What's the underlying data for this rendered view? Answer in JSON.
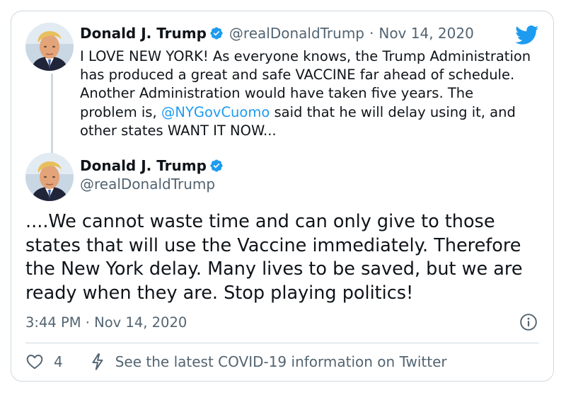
{
  "icons": {
    "logo": "twitter-bird-icon",
    "verified": "verified-badge-icon",
    "info": "info-icon",
    "like": "heart-icon",
    "covid": "lightning-bolt-icon"
  },
  "colors": {
    "accent": "#1d9bf0",
    "secondary_text": "#536471",
    "border": "#cfd9de"
  },
  "tweet1": {
    "name": "Donald J. Trump",
    "handle": "@realDonaldTrump",
    "separator": "·",
    "date": "Nov 14, 2020",
    "text_before": "I LOVE NEW YORK! As everyone knows, the Trump Administration has produced a great and safe VACCINE far ahead of schedule. Another Administration would have taken five years. The problem is, ",
    "mention": "@NYGovCuomo",
    "text_after": " said that he will delay using it, and other states WANT IT NOW..."
  },
  "tweet2": {
    "name": "Donald J. Trump",
    "handle": "@realDonaldTrump",
    "text": "....We cannot waste time and can only give to those states that will use the Vaccine immediately. Therefore the New York delay. Many lives to be saved, but we are ready when they are. Stop playing politics!",
    "timestamp": "3:44 PM · Nov 14, 2020"
  },
  "actions": {
    "like_count": "4",
    "covid_label": "See the latest COVID-19 information on Twitter"
  }
}
